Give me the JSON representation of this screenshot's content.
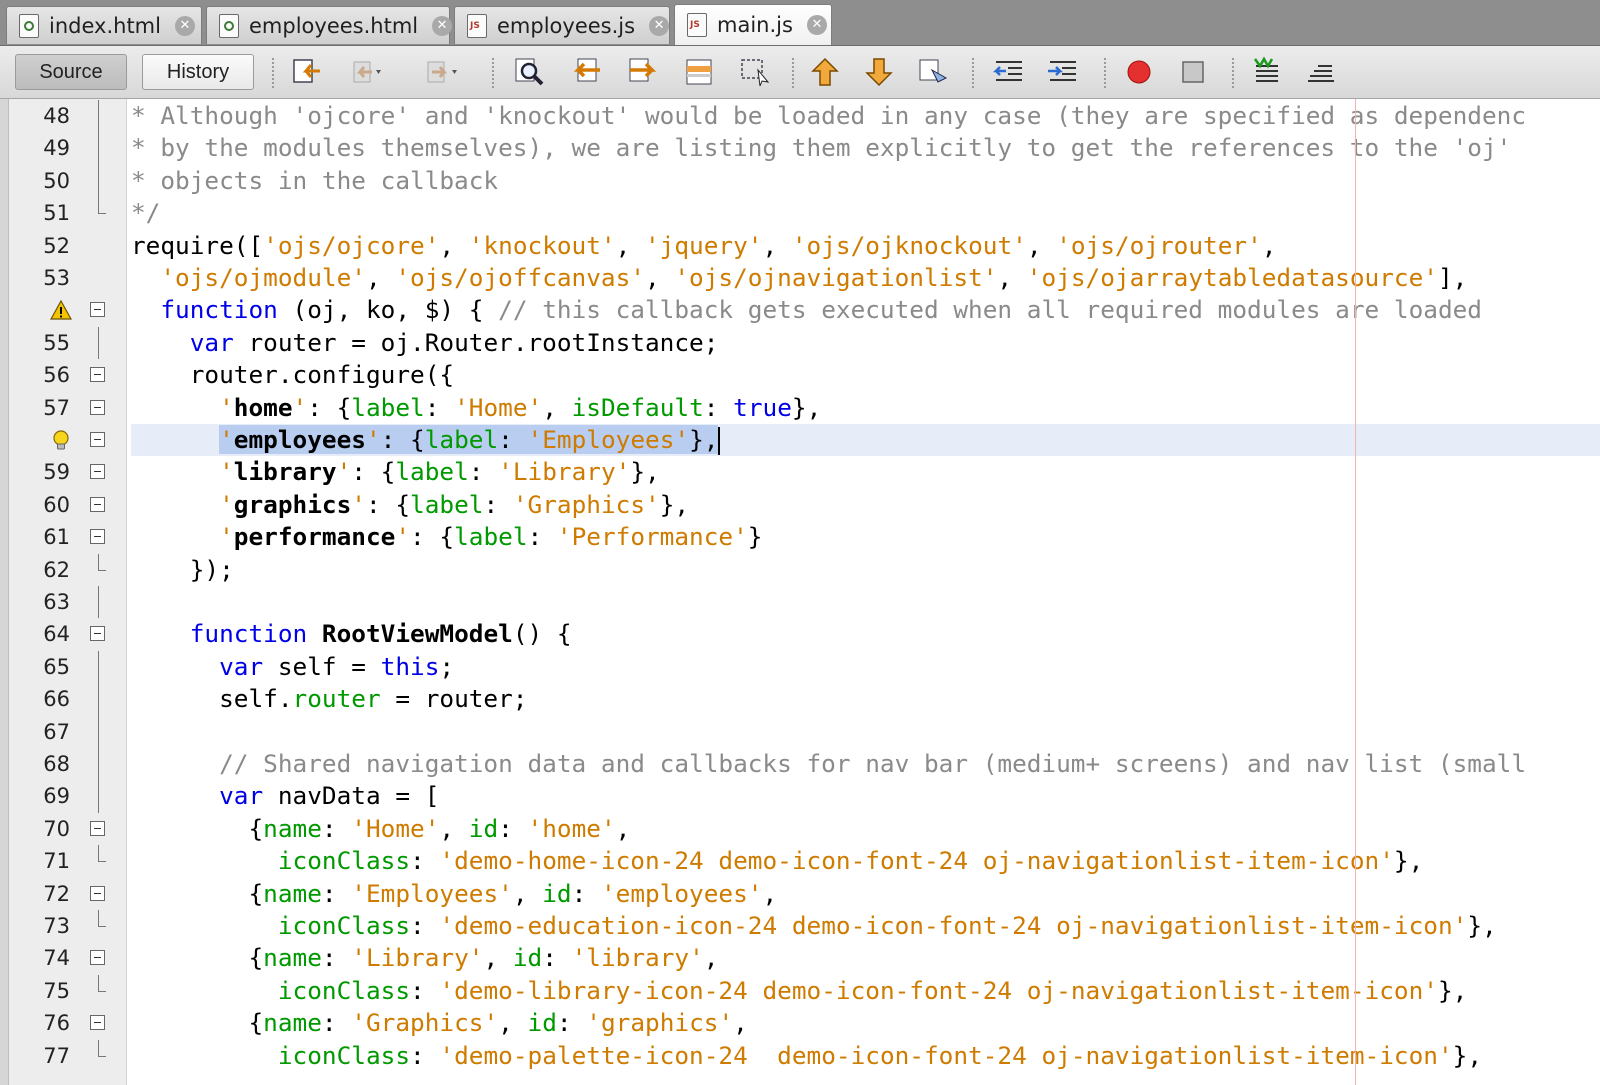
{
  "tabs": [
    {
      "label": "index.html",
      "kind": "html",
      "active": false
    },
    {
      "label": "employees.html",
      "kind": "html",
      "active": false
    },
    {
      "label": "employees.js",
      "kind": "js",
      "active": false
    },
    {
      "label": "main.js",
      "kind": "js",
      "active": true
    }
  ],
  "toolbar": {
    "source_label": "Source",
    "history_label": "History",
    "icons": [
      "last-edit-icon",
      "back-icon",
      "forward-icon",
      "find-icon",
      "find-previous-icon",
      "find-next-icon",
      "toggle-highlight-icon",
      "toggle-rect-select-icon",
      "previous-bookmark-icon",
      "next-bookmark-icon",
      "toggle-bookmark-icon",
      "shift-left-icon",
      "shift-right-icon",
      "start-macro-icon",
      "stop-macro-icon",
      "comment-icon",
      "uncomment-icon"
    ]
  },
  "colors": {
    "comment": "#8a8a8a",
    "string": "#ce7b00",
    "keyword": "#0000e6",
    "property": "#009900",
    "selection": "#b8cdf0",
    "current_line": "#e6ecf8"
  },
  "editor": {
    "lines": [
      {
        "num": "48",
        "marker": "",
        "fold": "line",
        "segs": [
          [
            "cm",
            "* Although 'ojcore' and 'knockout' would be loaded in any case (they are specified as dependenc"
          ]
        ]
      },
      {
        "num": "49",
        "marker": "",
        "fold": "line",
        "segs": [
          [
            "cm",
            "* by the modules themselves), we are listing them explicitly to get the references to the 'oj'"
          ]
        ]
      },
      {
        "num": "50",
        "marker": "",
        "fold": "line",
        "segs": [
          [
            "cm",
            "* objects in the callback"
          ]
        ]
      },
      {
        "num": "51",
        "marker": "",
        "fold": "end",
        "segs": [
          [
            "cm",
            "*/"
          ]
        ]
      },
      {
        "num": "52",
        "marker": "",
        "fold": "",
        "segs": [
          [
            "",
            "require(["
          ],
          [
            "str",
            "'ojs/ojcore'"
          ],
          [
            "",
            ", "
          ],
          [
            "str",
            "'knockout'"
          ],
          [
            "",
            ", "
          ],
          [
            "str",
            "'jquery'"
          ],
          [
            "",
            ", "
          ],
          [
            "str",
            "'ojs/ojknockout'"
          ],
          [
            "",
            ", "
          ],
          [
            "str",
            "'ojs/ojrouter'"
          ],
          [
            "",
            ","
          ]
        ]
      },
      {
        "num": "53",
        "marker": "",
        "fold": "",
        "segs": [
          [
            "",
            "  "
          ],
          [
            "str",
            "'ojs/ojmodule'"
          ],
          [
            "",
            ", "
          ],
          [
            "str",
            "'ojs/ojoffcanvas'"
          ],
          [
            "",
            ", "
          ],
          [
            "str",
            "'ojs/ojnavigationlist'"
          ],
          [
            "",
            ", "
          ],
          [
            "str",
            "'ojs/ojarraytabledatasource'"
          ],
          [
            "",
            "],"
          ]
        ]
      },
      {
        "num": "",
        "marker": "warning",
        "fold": "box",
        "segs": [
          [
            "",
            "  "
          ],
          [
            "kw",
            "function"
          ],
          [
            "",
            " (oj, ko, $) { "
          ],
          [
            "cm",
            "// this callback gets executed when all required modules are loaded"
          ]
        ]
      },
      {
        "num": "55",
        "marker": "",
        "fold": "line",
        "segs": [
          [
            "",
            "    "
          ],
          [
            "kw",
            "var"
          ],
          [
            "",
            " router = oj.Router.rootInstance;"
          ]
        ]
      },
      {
        "num": "56",
        "marker": "",
        "fold": "box",
        "segs": [
          [
            "",
            "    router.configure({"
          ]
        ]
      },
      {
        "num": "57",
        "marker": "",
        "fold": "box",
        "segs": [
          [
            "",
            "      "
          ],
          [
            "str",
            "'"
          ],
          [
            "b",
            "home"
          ],
          [
            "str",
            "'"
          ],
          [
            "",
            ": {"
          ],
          [
            "prop",
            "label"
          ],
          [
            "",
            ": "
          ],
          [
            "str",
            "'Home'"
          ],
          [
            "",
            ", "
          ],
          [
            "prop",
            "isDefault"
          ],
          [
            "",
            ": "
          ],
          [
            "kw",
            "true"
          ],
          [
            "",
            "},"
          ]
        ]
      },
      {
        "num": "",
        "marker": "bulb",
        "fold": "box",
        "hl": true,
        "segs": [
          [
            "",
            "      "
          ],
          [
            "selstr",
            "'"
          ],
          [
            "selb",
            "employees"
          ],
          [
            "selstr",
            "'"
          ],
          [
            "sel",
            ": {"
          ],
          [
            "selprop",
            "label"
          ],
          [
            "sel",
            ": "
          ],
          [
            "selstr",
            "'Employees'"
          ],
          [
            "sel",
            "},"
          ],
          [
            "caret",
            ""
          ]
        ]
      },
      {
        "num": "59",
        "marker": "",
        "fold": "box",
        "segs": [
          [
            "",
            "      "
          ],
          [
            "str",
            "'"
          ],
          [
            "b",
            "library"
          ],
          [
            "str",
            "'"
          ],
          [
            "",
            ": {"
          ],
          [
            "prop",
            "label"
          ],
          [
            "",
            ": "
          ],
          [
            "str",
            "'Library'"
          ],
          [
            "",
            "},"
          ]
        ]
      },
      {
        "num": "60",
        "marker": "",
        "fold": "box",
        "segs": [
          [
            "",
            "      "
          ],
          [
            "str",
            "'"
          ],
          [
            "b",
            "graphics"
          ],
          [
            "str",
            "'"
          ],
          [
            "",
            ": {"
          ],
          [
            "prop",
            "label"
          ],
          [
            "",
            ": "
          ],
          [
            "str",
            "'Graphics'"
          ],
          [
            "",
            "},"
          ]
        ]
      },
      {
        "num": "61",
        "marker": "",
        "fold": "box",
        "segs": [
          [
            "",
            "      "
          ],
          [
            "str",
            "'"
          ],
          [
            "b",
            "performance"
          ],
          [
            "str",
            "'"
          ],
          [
            "",
            ": {"
          ],
          [
            "prop",
            "label"
          ],
          [
            "",
            ": "
          ],
          [
            "str",
            "'Performance'"
          ],
          [
            "",
            "}"
          ]
        ]
      },
      {
        "num": "62",
        "marker": "",
        "fold": "end",
        "segs": [
          [
            "",
            "    });"
          ]
        ]
      },
      {
        "num": "63",
        "marker": "",
        "fold": "line",
        "segs": [
          [
            "",
            ""
          ]
        ]
      },
      {
        "num": "64",
        "marker": "",
        "fold": "box",
        "segs": [
          [
            "",
            "    "
          ],
          [
            "kw",
            "function"
          ],
          [
            "",
            " "
          ],
          [
            "b",
            "RootViewModel"
          ],
          [
            "",
            "() {"
          ]
        ]
      },
      {
        "num": "65",
        "marker": "",
        "fold": "line",
        "segs": [
          [
            "",
            "      "
          ],
          [
            "kw",
            "var"
          ],
          [
            "",
            " self = "
          ],
          [
            "kw",
            "this"
          ],
          [
            "",
            ";"
          ]
        ]
      },
      {
        "num": "66",
        "marker": "",
        "fold": "line",
        "segs": [
          [
            "",
            "      self."
          ],
          [
            "prop",
            "router"
          ],
          [
            "",
            " = router;"
          ]
        ]
      },
      {
        "num": "67",
        "marker": "",
        "fold": "line",
        "segs": [
          [
            "",
            ""
          ]
        ]
      },
      {
        "num": "68",
        "marker": "",
        "fold": "line",
        "segs": [
          [
            "",
            "      "
          ],
          [
            "cm",
            "// Shared navigation data and callbacks for nav bar (medium+ screens) and nav list (small"
          ]
        ]
      },
      {
        "num": "69",
        "marker": "",
        "fold": "line",
        "segs": [
          [
            "",
            "      "
          ],
          [
            "kw",
            "var"
          ],
          [
            "",
            " navData = ["
          ]
        ]
      },
      {
        "num": "70",
        "marker": "",
        "fold": "box",
        "segs": [
          [
            "",
            "        {"
          ],
          [
            "prop",
            "name"
          ],
          [
            "",
            ": "
          ],
          [
            "str",
            "'Home'"
          ],
          [
            "",
            ", "
          ],
          [
            "prop",
            "id"
          ],
          [
            "",
            ": "
          ],
          [
            "str",
            "'home'"
          ],
          [
            "",
            ","
          ]
        ]
      },
      {
        "num": "71",
        "marker": "",
        "fold": "end",
        "segs": [
          [
            "",
            "          "
          ],
          [
            "prop",
            "iconClass"
          ],
          [
            "",
            ": "
          ],
          [
            "str",
            "'demo-home-icon-24 demo-icon-font-24 oj-navigationlist-item-icon'"
          ],
          [
            "",
            "},"
          ]
        ]
      },
      {
        "num": "72",
        "marker": "",
        "fold": "box",
        "segs": [
          [
            "",
            "        {"
          ],
          [
            "prop",
            "name"
          ],
          [
            "",
            ": "
          ],
          [
            "str",
            "'Employees'"
          ],
          [
            "",
            ", "
          ],
          [
            "prop",
            "id"
          ],
          [
            "",
            ": "
          ],
          [
            "str",
            "'employees'"
          ],
          [
            "",
            ","
          ]
        ]
      },
      {
        "num": "73",
        "marker": "",
        "fold": "end",
        "segs": [
          [
            "",
            "          "
          ],
          [
            "prop",
            "iconClass"
          ],
          [
            "",
            ": "
          ],
          [
            "str",
            "'demo-education-icon-24 demo-icon-font-24 oj-navigationlist-item-icon'"
          ],
          [
            "",
            "},"
          ]
        ]
      },
      {
        "num": "74",
        "marker": "",
        "fold": "box",
        "segs": [
          [
            "",
            "        {"
          ],
          [
            "prop",
            "name"
          ],
          [
            "",
            ": "
          ],
          [
            "str",
            "'Library'"
          ],
          [
            "",
            ", "
          ],
          [
            "prop",
            "id"
          ],
          [
            "",
            ": "
          ],
          [
            "str",
            "'library'"
          ],
          [
            "",
            ","
          ]
        ]
      },
      {
        "num": "75",
        "marker": "",
        "fold": "end",
        "segs": [
          [
            "",
            "          "
          ],
          [
            "prop",
            "iconClass"
          ],
          [
            "",
            ": "
          ],
          [
            "str",
            "'demo-library-icon-24 demo-icon-font-24 oj-navigationlist-item-icon'"
          ],
          [
            "",
            "},"
          ]
        ]
      },
      {
        "num": "76",
        "marker": "",
        "fold": "box",
        "segs": [
          [
            "",
            "        {"
          ],
          [
            "prop",
            "name"
          ],
          [
            "",
            ": "
          ],
          [
            "str",
            "'Graphics'"
          ],
          [
            "",
            ", "
          ],
          [
            "prop",
            "id"
          ],
          [
            "",
            ": "
          ],
          [
            "str",
            "'graphics'"
          ],
          [
            "",
            ","
          ]
        ]
      },
      {
        "num": "77",
        "marker": "",
        "fold": "end",
        "segs": [
          [
            "",
            "          "
          ],
          [
            "prop",
            "iconClass"
          ],
          [
            "",
            ": "
          ],
          [
            "str",
            "'demo-palette-icon-24  demo-icon-font-24 oj-navigationlist-item-icon'"
          ],
          [
            "",
            "},"
          ]
        ]
      }
    ]
  }
}
